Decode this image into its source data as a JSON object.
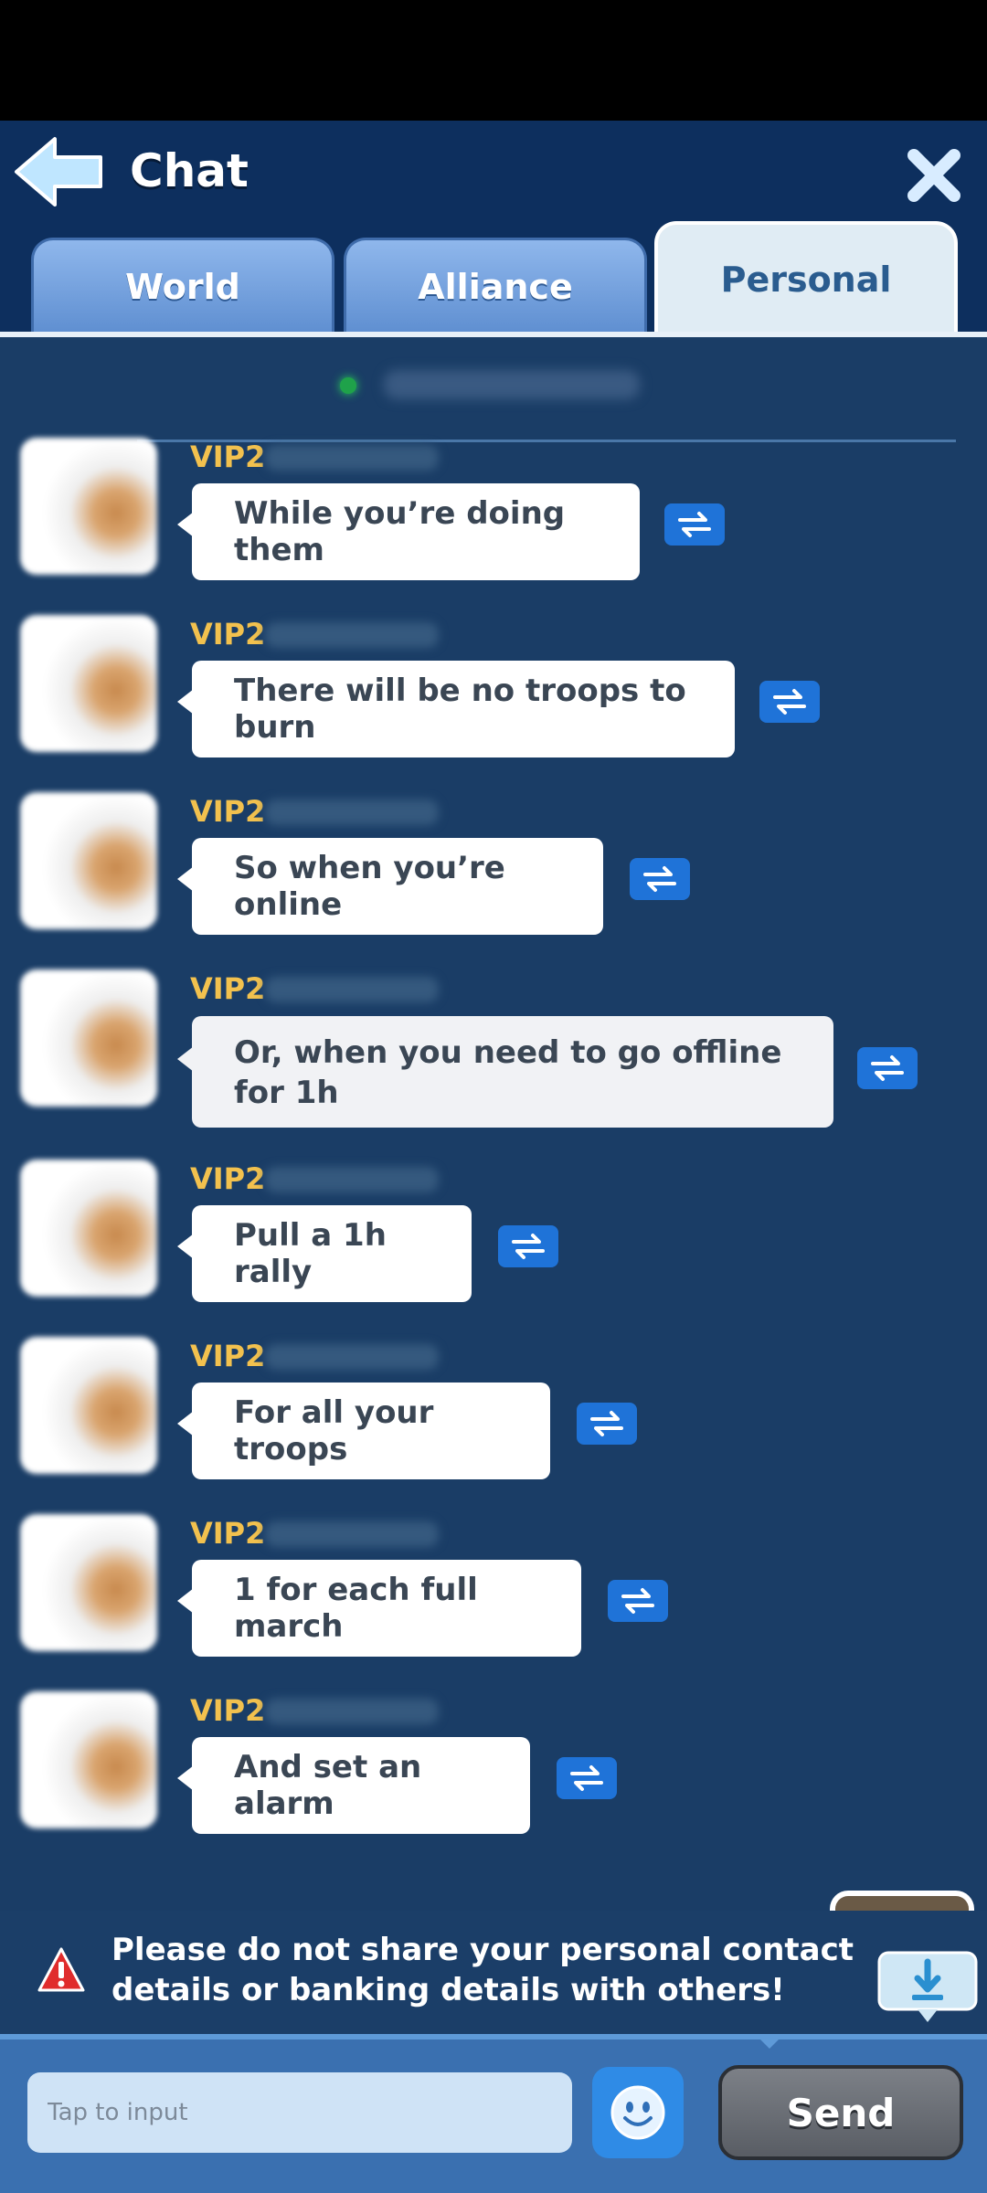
{
  "header": {
    "title": "Chat",
    "tabs": [
      {
        "label": "World",
        "active": false
      },
      {
        "label": "Alliance",
        "active": false
      },
      {
        "label": "Personal",
        "active": true
      }
    ]
  },
  "messages": [
    {
      "vip": "VIP2",
      "text": "While you’re doing them"
    },
    {
      "vip": "VIP2",
      "text": "There will be no troops to burn"
    },
    {
      "vip": "VIP2",
      "text": "So when you’re online"
    },
    {
      "vip": "VIP2",
      "text": "Or, when you need to go offline for 1h"
    },
    {
      "vip": "VIP2",
      "text": "Pull a 1h rally"
    },
    {
      "vip": "VIP2",
      "text": "For all your troops"
    },
    {
      "vip": "VIP2",
      "text": "1 for each full march"
    },
    {
      "vip": "VIP2",
      "text": "And set an alarm"
    }
  ],
  "warning": {
    "text": "Please do not share your personal contact details or banking details with others!"
  },
  "input": {
    "placeholder": "Tap to input",
    "send_label": "Send"
  },
  "colors": {
    "header_bg": "#0d2f5e",
    "chat_bg": "#1a3d66",
    "vip_gold": "#f2c14e",
    "translate_blue": "#1f73d8",
    "warning_red": "#e02c2c"
  },
  "icons": [
    "back-arrow-icon",
    "close-icon",
    "translate-icon",
    "warning-icon",
    "download-icon",
    "emoji-icon"
  ]
}
